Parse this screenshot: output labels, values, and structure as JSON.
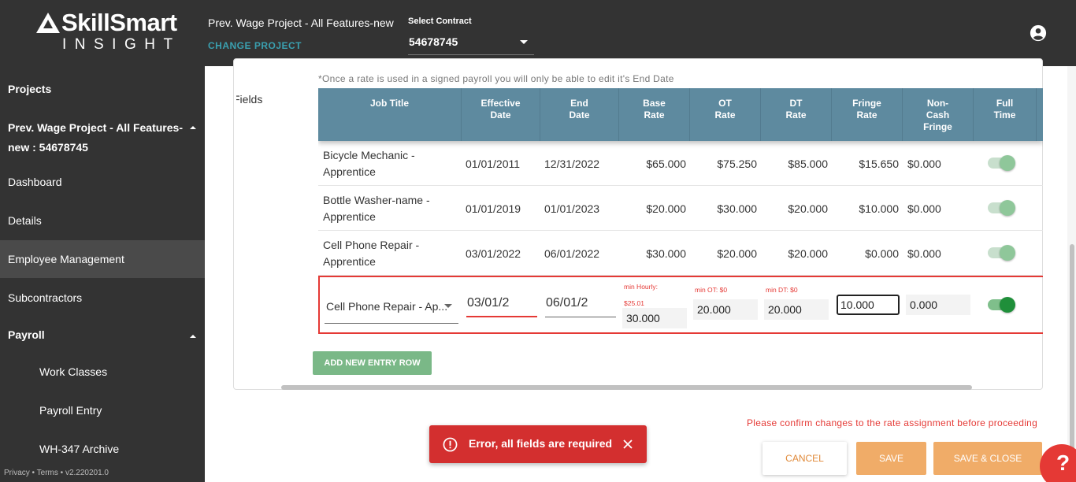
{
  "app": {
    "logo_top": "SkillSmart",
    "logo_bottom": "INSIGHT",
    "project_name": "Prev. Wage Project - All Features-new",
    "change_project": "CHANGE PROJECT",
    "contract_label": "Select Contract",
    "contract_value": "54678745"
  },
  "sidebar": {
    "projects": "Projects",
    "current_project": "Prev. Wage Project - All Features-new : 54678745",
    "items": [
      "Dashboard",
      "Details",
      "Employee Management",
      "Subcontractors"
    ],
    "payroll": "Payroll",
    "payroll_items": [
      "Work Classes",
      "Payroll Entry",
      "WH-347 Archive"
    ],
    "footer": "Privacy • Terms • v2.220201.0"
  },
  "section": {
    "fields_label": "Fields",
    "notice": "*Once a rate is used in a signed payroll you will only be able to edit it's End Date"
  },
  "table": {
    "headers": [
      "Job Title",
      "Effective Date",
      "End Date",
      "Base Rate",
      "OT Rate",
      "DT Rate",
      "Fringe Rate",
      "Non-Cash Fringe",
      "Full Time"
    ],
    "rows": [
      {
        "title": "Bicycle Mechanic - Apprentice",
        "effective": "01/01/2011",
        "end": "12/31/2022",
        "base": "$65.000",
        "ot": "$75.250",
        "dt": "$85.000",
        "fringe": "$15.650",
        "noncash": "$0.000"
      },
      {
        "title": "Bottle Washer-name - Apprentice",
        "effective": "01/01/2019",
        "end": "01/01/2023",
        "base": "$20.000",
        "ot": "$30.000",
        "dt": "$20.000",
        "fringe": "$10.000",
        "noncash": "$0.000"
      },
      {
        "title": "Cell Phone Repair - Apprentice",
        "effective": "03/01/2022",
        "end": "06/01/2022",
        "base": "$30.000",
        "ot": "$20.000",
        "dt": "$20.000",
        "fringe": "$0.000",
        "noncash": "$0.000"
      }
    ],
    "edit_row": {
      "title": "Cell Phone Repair - Ap...",
      "effective": "03/01/2",
      "end": "06/01/2",
      "min_hourly": "min Hourly: $25.01",
      "min_ot": "min OT: $0",
      "min_dt": "min DT: $0",
      "base": "30.000",
      "ot": "20.000",
      "dt": "20.000",
      "fringe": "10.000",
      "noncash": "0.000"
    }
  },
  "actions": {
    "add_row": "ADD NEW ENTRY ROW",
    "confirm_msg": "Please confirm changes to the rate assignment before proceeding",
    "cancel": "CANCEL",
    "save": "SAVE",
    "save_close": "SAVE & CLOSE",
    "help": "?"
  },
  "toast": {
    "message": "Error, all fields are required"
  },
  "colors": {
    "sidebar_bg": "#333333",
    "header_bg": "#5e8a9f",
    "accent_orange": "#f0ac68",
    "error_red": "#d32f2f",
    "add_green": "#7ab887",
    "link_teal": "#3aa0b0"
  }
}
